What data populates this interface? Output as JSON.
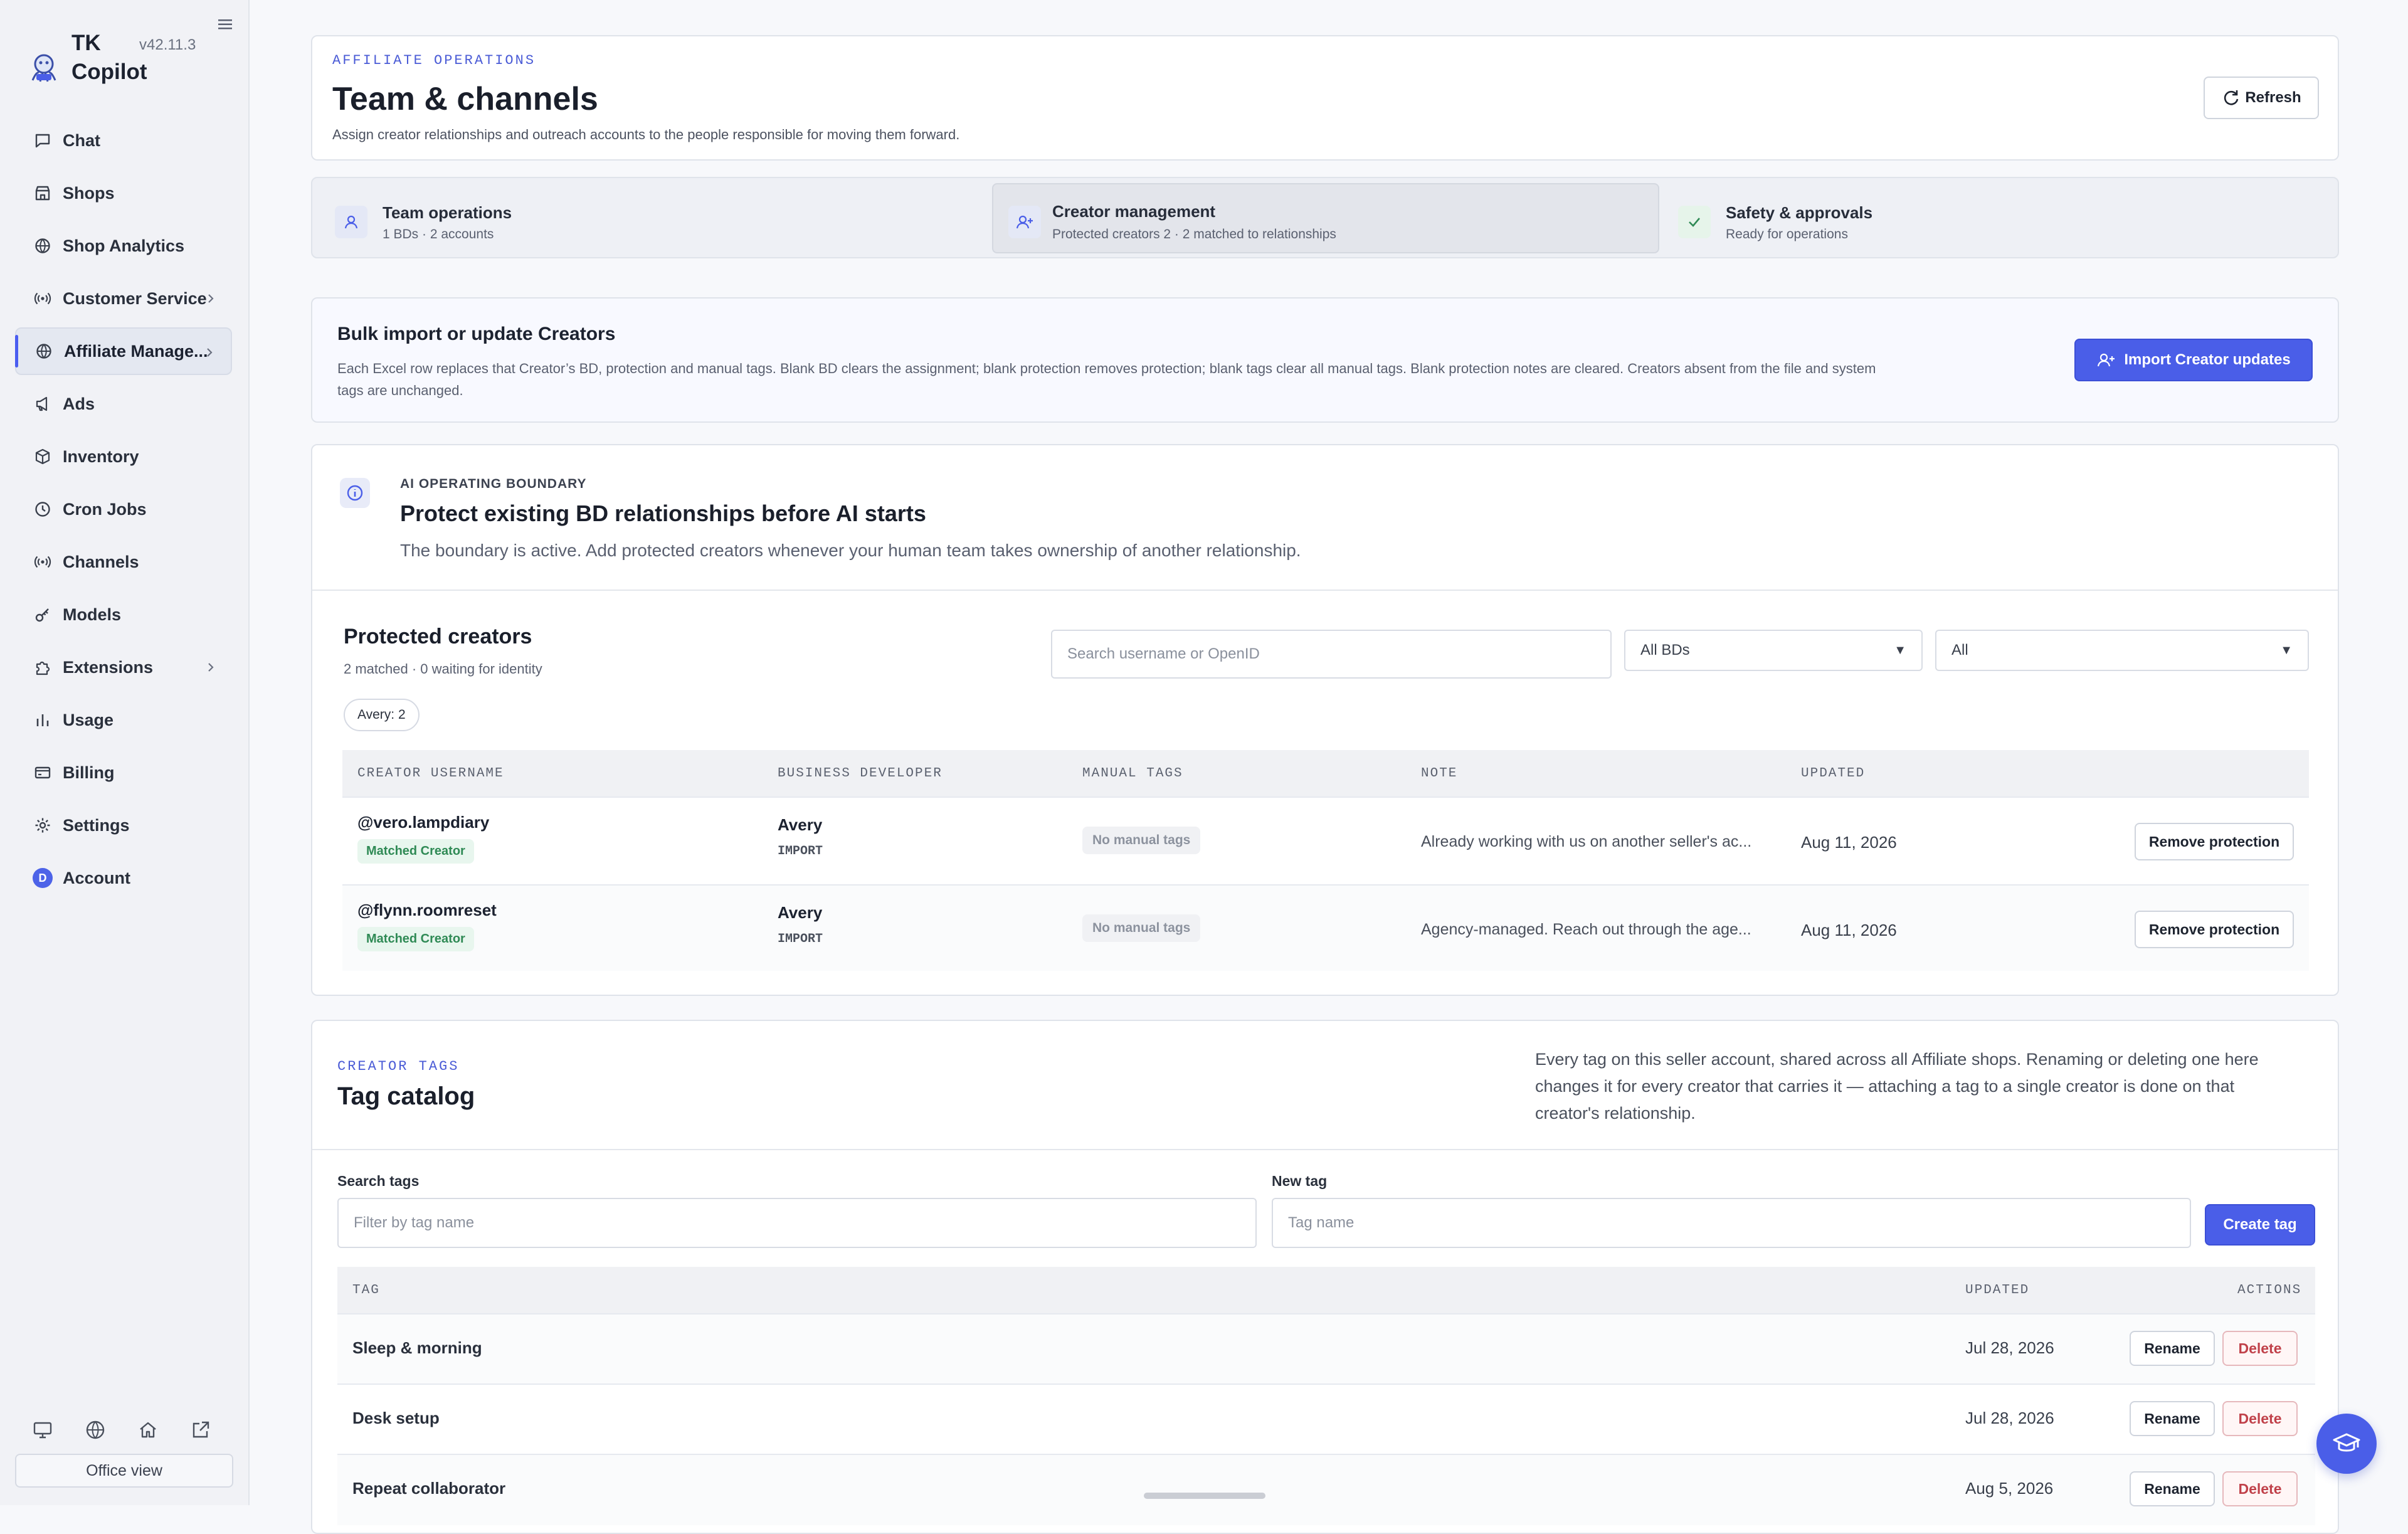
{
  "app": {
    "name": "TK Copilot",
    "version": "v42.11.3"
  },
  "sidebar": {
    "items": [
      {
        "label": "Chat",
        "icon": "chat-icon"
      },
      {
        "label": "Shops",
        "icon": "store-icon"
      },
      {
        "label": "Shop Analytics",
        "icon": "globe-icon"
      },
      {
        "label": "Customer Service",
        "icon": "broadcast-icon"
      },
      {
        "label": "Affiliate Manage...",
        "icon": "globe-icon"
      },
      {
        "label": "Ads",
        "icon": "megaphone-icon"
      },
      {
        "label": "Inventory",
        "icon": "box-icon"
      },
      {
        "label": "Cron Jobs",
        "icon": "clock-icon"
      },
      {
        "label": "Channels",
        "icon": "broadcast-icon"
      },
      {
        "label": "Models",
        "icon": "key-icon"
      },
      {
        "label": "Extensions",
        "icon": "puzzle-icon"
      },
      {
        "label": "Usage",
        "icon": "bar-chart-icon"
      },
      {
        "label": "Billing",
        "icon": "card-icon"
      },
      {
        "label": "Settings",
        "icon": "gear-icon"
      },
      {
        "label": "Account",
        "icon": "avatar-icon",
        "avatar_letter": "D"
      }
    ],
    "office_view": "Office view"
  },
  "header": {
    "eyebrow": "AFFILIATE OPERATIONS",
    "title": "Team & channels",
    "subtitle": "Assign creator relationships and outreach accounts to the people responsible for moving them forward.",
    "refresh": "Refresh"
  },
  "tabs": [
    {
      "title": "Team operations",
      "sub": "1 BDs · 2 accounts"
    },
    {
      "title": "Creator management",
      "sub": "Protected creators 2 · 2 matched to relationships"
    },
    {
      "title": "Safety & approvals",
      "sub": "Ready for operations"
    }
  ],
  "import": {
    "title": "Bulk import or update Creators",
    "desc_1": "Each Excel row replaces that Creator’s BD, protection and manual tags. Blank BD clears the assignment; blank protection removes protection; blank tags clear all manual tags. Blank protection notes are cleared. Creators absent from the file and system",
    "desc_2": "tags are unchanged.",
    "button": "Import Creator updates"
  },
  "boundary": {
    "eyebrow": "AI OPERATING BOUNDARY",
    "title": "Protect existing BD relationships before AI starts",
    "desc": "The boundary is active. Add protected creators whenever your human team takes ownership of another relationship."
  },
  "protected": {
    "title": "Protected creators",
    "summary": "2 matched · 0 waiting for identity",
    "chip": "Avery: 2",
    "search_placeholder": "Search username or OpenID",
    "bd_filter": "All BDs",
    "status_filter": "All",
    "columns": [
      "CREATOR USERNAME",
      "BUSINESS DEVELOPER",
      "MANUAL TAGS",
      "NOTE",
      "UPDATED"
    ],
    "rows": [
      {
        "username": "@vero.lampdiary",
        "badge": "Matched Creator",
        "bd": "Avery",
        "bd_source": "IMPORT",
        "tags": "No manual tags",
        "note": "Already working with us on another seller's ac...",
        "updated": "Aug 11, 2026",
        "action": "Remove protection"
      },
      {
        "username": "@flynn.roomreset",
        "badge": "Matched Creator",
        "bd": "Avery",
        "bd_source": "IMPORT",
        "tags": "No manual tags",
        "note": "Agency-managed. Reach out through the age...",
        "updated": "Aug 11, 2026",
        "action": "Remove protection"
      }
    ]
  },
  "tag_catalog": {
    "eyebrow": "CREATOR TAGS",
    "title": "Tag catalog",
    "desc_1": "Every tag on this seller account, shared across all Affiliate shops. Renaming or deleting one here",
    "desc_2": "changes it for every creator that carries it — attaching a tag to a single creator is done on that",
    "desc_3": "creator's relationship.",
    "search_label": "Search tags",
    "search_placeholder": "Filter by tag name",
    "new_label": "New tag",
    "new_placeholder": "Tag name",
    "create_button": "Create tag",
    "columns": [
      "TAG",
      "UPDATED",
      "ACTIONS"
    ],
    "rows": [
      {
        "tag": "Sleep & morning",
        "updated": "Jul 28, 2026"
      },
      {
        "tag": "Desk setup",
        "updated": "Jul 28, 2026"
      },
      {
        "tag": "Repeat collaborator",
        "updated": "Aug 5, 2026"
      }
    ],
    "rename": "Rename",
    "delete": "Delete"
  },
  "colors": {
    "accent": "#4a5ee8",
    "success": "#2f8a55",
    "danger": "#c0414a"
  }
}
